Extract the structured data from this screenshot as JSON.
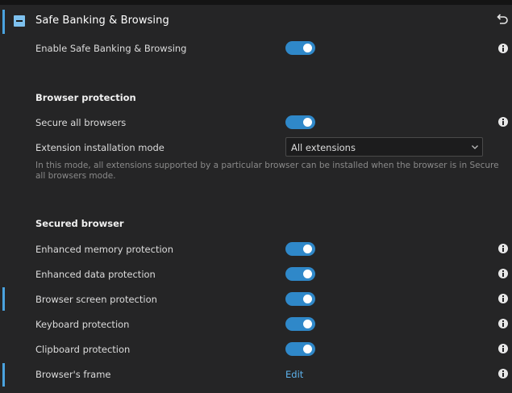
{
  "header": {
    "title": "Safe Banking & Browsing"
  },
  "rows": {
    "enable": {
      "label": "Enable Safe Banking & Browsing",
      "on": true
    }
  },
  "browser_protection": {
    "heading": "Browser protection",
    "secure_all": {
      "label": "Secure all browsers",
      "on": true
    },
    "extension_mode": {
      "label": "Extension installation mode",
      "selected": "All extensions",
      "description": "In this mode, all extensions supported by a particular browser can be installed when the browser is in Secure all browsers mode."
    }
  },
  "secured_browser": {
    "heading": "Secured browser",
    "items": [
      {
        "label": "Enhanced memory protection",
        "on": true
      },
      {
        "label": "Enhanced data protection",
        "on": true
      },
      {
        "label": "Browser screen protection",
        "on": true
      },
      {
        "label": "Keyboard protection",
        "on": true
      },
      {
        "label": "Clipboard protection",
        "on": true
      }
    ],
    "frame": {
      "label": "Browser's frame",
      "link": "Edit"
    }
  },
  "icons": [
    "collapse-icon",
    "undo-icon",
    "info-icon",
    "chevron-down-icon"
  ],
  "colors": {
    "accent": "#4aa3df",
    "toggle_on": "#2f88c9",
    "link": "#5db2ec",
    "background": "#252526"
  }
}
